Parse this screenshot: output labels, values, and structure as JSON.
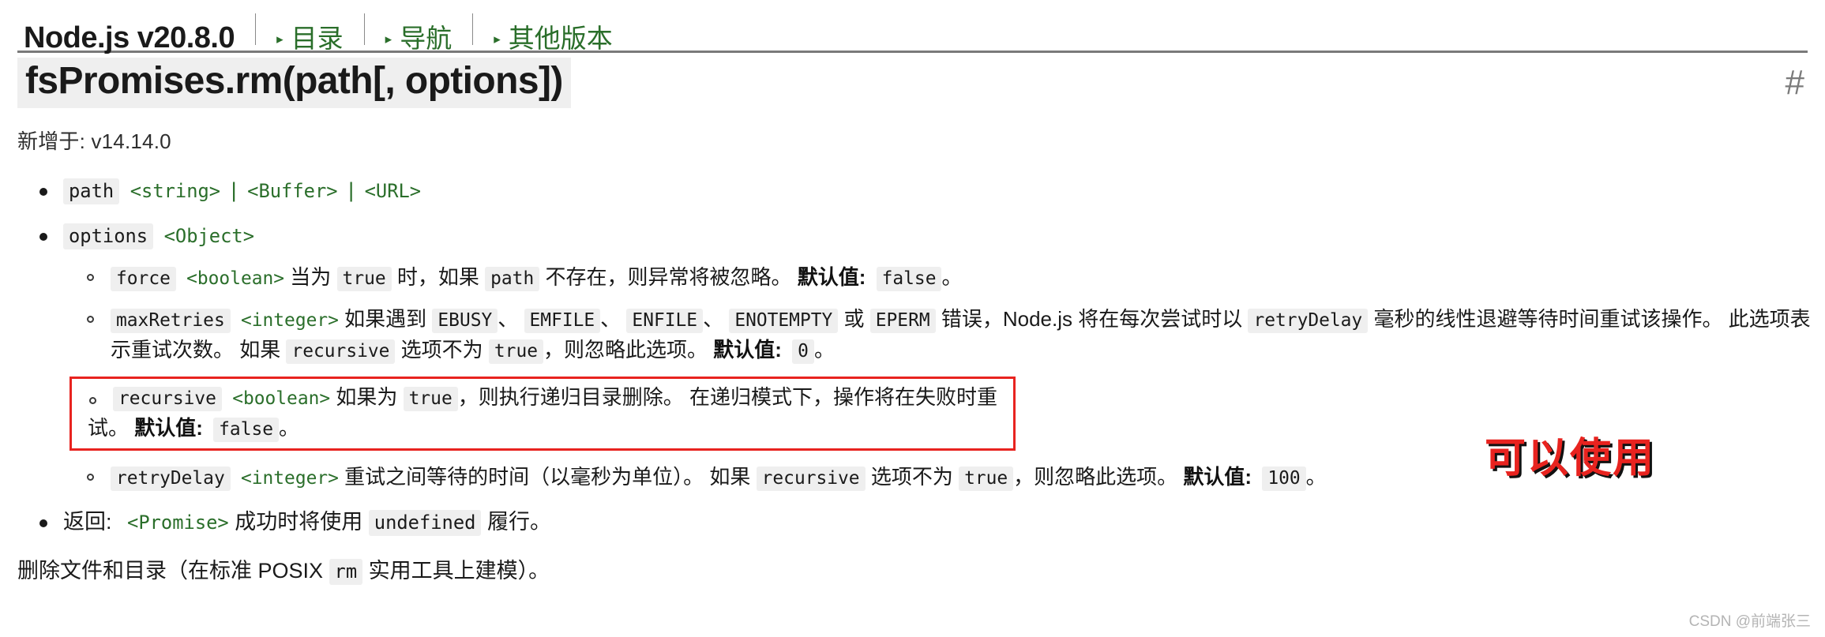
{
  "nav": {
    "title": "Node.js v20.8.0",
    "links": [
      {
        "label": "目录",
        "caret": "caret-right-icon"
      },
      {
        "label": "导航",
        "caret": "caret-right-icon"
      },
      {
        "label": "其他版本",
        "caret": "caret-right-icon"
      }
    ]
  },
  "heading": {
    "title": "fsPromises.rm(path[, options])",
    "anchor": "#"
  },
  "meta": {
    "added": "新增于: v14.14.0"
  },
  "params": {
    "path": {
      "name": "path",
      "types": [
        "<string>",
        "<Buffer>",
        "<URL>"
      ],
      "pipe": "|"
    },
    "options": {
      "name": "options",
      "type": "<Object>"
    },
    "force": {
      "name": "force",
      "type": "<boolean>",
      "t1": "当为",
      "c1": "true",
      "t2": "时，如果",
      "c2": "path",
      "t3": "不存在，则异常将被忽略。",
      "default_label": "默认值:",
      "default_value": "false",
      "period": "。"
    },
    "maxRetries": {
      "name": "maxRetries",
      "type": "<integer>",
      "t1": "如果遇到",
      "e1": "EBUSY",
      "sep1": "、",
      "e2": "EMFILE",
      "sep2": "、",
      "e3": "ENFILE",
      "sep3": "、",
      "e4": "ENOTEMPTY",
      "t2": "或",
      "e5": "EPERM",
      "t3": "错误，Node.js 将在每次尝试时以",
      "c1": "retryDelay",
      "t4": "毫秒的线性退避等待时间重试该操作。 此选项表示重试次数。 如果",
      "c2": "recursive",
      "t5": "选项不为",
      "c3": "true",
      "t6": "，则忽略此选项。",
      "default_label": "默认值:",
      "default_value": "0",
      "period": "。"
    },
    "recursive": {
      "name": "recursive",
      "type": "<boolean>",
      "t1": "如果为",
      "c1": "true",
      "t2": "，则执行递归目录删除。 在递归模式下，操作将在失败时重试。",
      "default_label": "默认值:",
      "default_value": "false",
      "period": "。"
    },
    "retryDelay": {
      "name": "retryDelay",
      "type": "<integer>",
      "t1": "重试之间等待的时间（以毫秒为单位）。 如果",
      "c1": "recursive",
      "t2": "选项不为",
      "c2": "true",
      "t3": "，则忽略此选项。",
      "default_label": "默认值:",
      "default_value": "100",
      "period": "。"
    },
    "returns": {
      "label": "返回:",
      "type": "<Promise>",
      "t1": "成功时将使用",
      "c1": "undefined",
      "t2": "履行。"
    }
  },
  "closing": {
    "t1": "删除文件和目录（在标准 POSIX",
    "c1": "rm",
    "t2": "实用工具上建模）。"
  },
  "annotation": {
    "text": "可以使用",
    "color": "#e8231f"
  },
  "watermark": {
    "text": "CSDN @前端张三"
  }
}
